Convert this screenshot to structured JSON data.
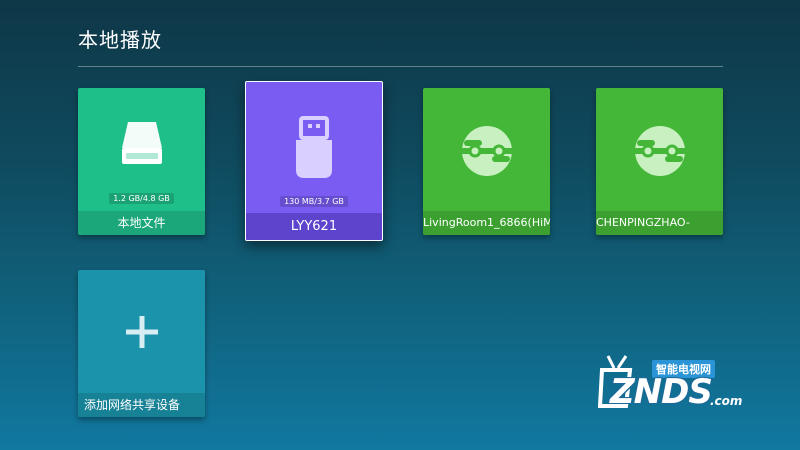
{
  "header": {
    "title": "本地播放"
  },
  "tiles": {
    "local": {
      "label": "本地文件",
      "capacity": "1.2 GB/4.8 GB",
      "color": "#1fbf8a",
      "icon": "hard-drive-icon"
    },
    "usb": {
      "label": "LYY621",
      "capacity": "130 MB/3.7 GB",
      "color": "#7a5cf2",
      "icon": "usb-drive-icon"
    },
    "net1": {
      "label": "LivingRoom1_6866(HiM",
      "color": "#45b738",
      "icon": "network-share-icon"
    },
    "net2": {
      "label": "CHENPINGZHAO-",
      "color": "#45b738",
      "icon": "network-share-icon"
    },
    "add": {
      "label": "添加网络共享设备",
      "color": "#1b93aa",
      "icon": "plus-icon"
    }
  },
  "watermark": {
    "cn": "智能电视网",
    "en": "ZNDS",
    "suffix": ".com"
  }
}
